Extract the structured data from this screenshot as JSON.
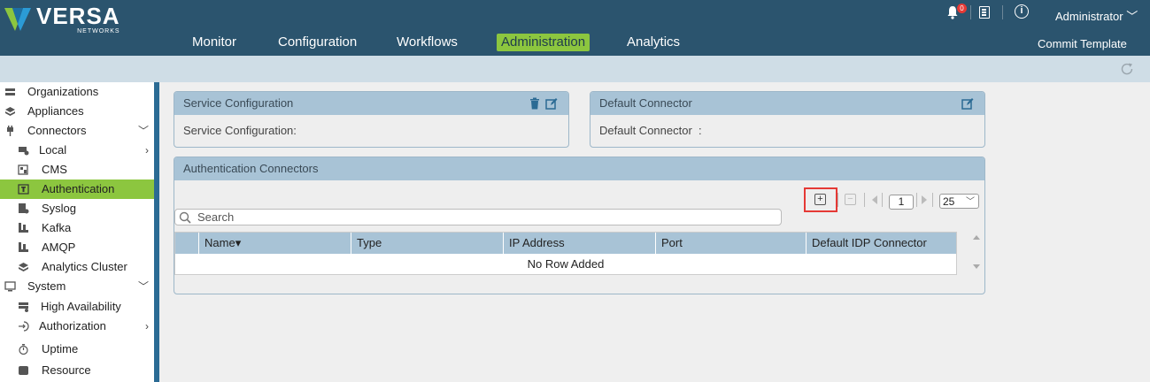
{
  "brand": {
    "name": "VERSA",
    "sub": "NETWORKS",
    "colors": {
      "blue": "#2b6b94",
      "green": "#8cc63f"
    }
  },
  "header": {
    "notifications_count": "0",
    "user": "Administrator",
    "commit_label": "Commit Template"
  },
  "nav": {
    "items": [
      "Monitor",
      "Configuration",
      "Workflows",
      "Administration",
      "Analytics"
    ],
    "active": "Administration"
  },
  "sidebar": {
    "items": [
      {
        "label": "Organizations",
        "icon": "organizations-icon"
      },
      {
        "label": "Appliances",
        "icon": "appliances-icon"
      },
      {
        "label": "Connectors",
        "icon": "connectors-icon"
      },
      {
        "label": "Local",
        "icon": "local-icon"
      },
      {
        "label": "CMS",
        "icon": "cms-icon"
      },
      {
        "label": "Authentication",
        "icon": "authentication-icon"
      },
      {
        "label": "Syslog",
        "icon": "syslog-icon"
      },
      {
        "label": "Kafka",
        "icon": "kafka-icon"
      },
      {
        "label": "AMQP",
        "icon": "amqp-icon"
      },
      {
        "label": "Analytics Cluster",
        "icon": "analytics-cluster-icon"
      },
      {
        "label": "System",
        "icon": "system-icon"
      },
      {
        "label": "High Availability",
        "icon": "high-availability-icon"
      },
      {
        "label": "Authorization",
        "icon": "authorization-icon"
      },
      {
        "label": "Uptime",
        "icon": "uptime-icon"
      },
      {
        "label": "Resource",
        "icon": "resource-icon"
      }
    ],
    "active": "Authentication"
  },
  "service_config": {
    "title": "Service Configuration",
    "field_label": "Service Configuration:"
  },
  "default_connector": {
    "title": "Default Connector",
    "field_label": "Default Connector  :"
  },
  "auth_connectors": {
    "title": "Authentication Connectors",
    "page": "1",
    "page_size": "25",
    "search_placeholder": "Search",
    "columns": [
      "Name",
      "Type",
      "IP Address",
      "Port",
      "Default IDP Connector"
    ],
    "sort_indicator": "▾",
    "empty_text": "No Row Added"
  }
}
